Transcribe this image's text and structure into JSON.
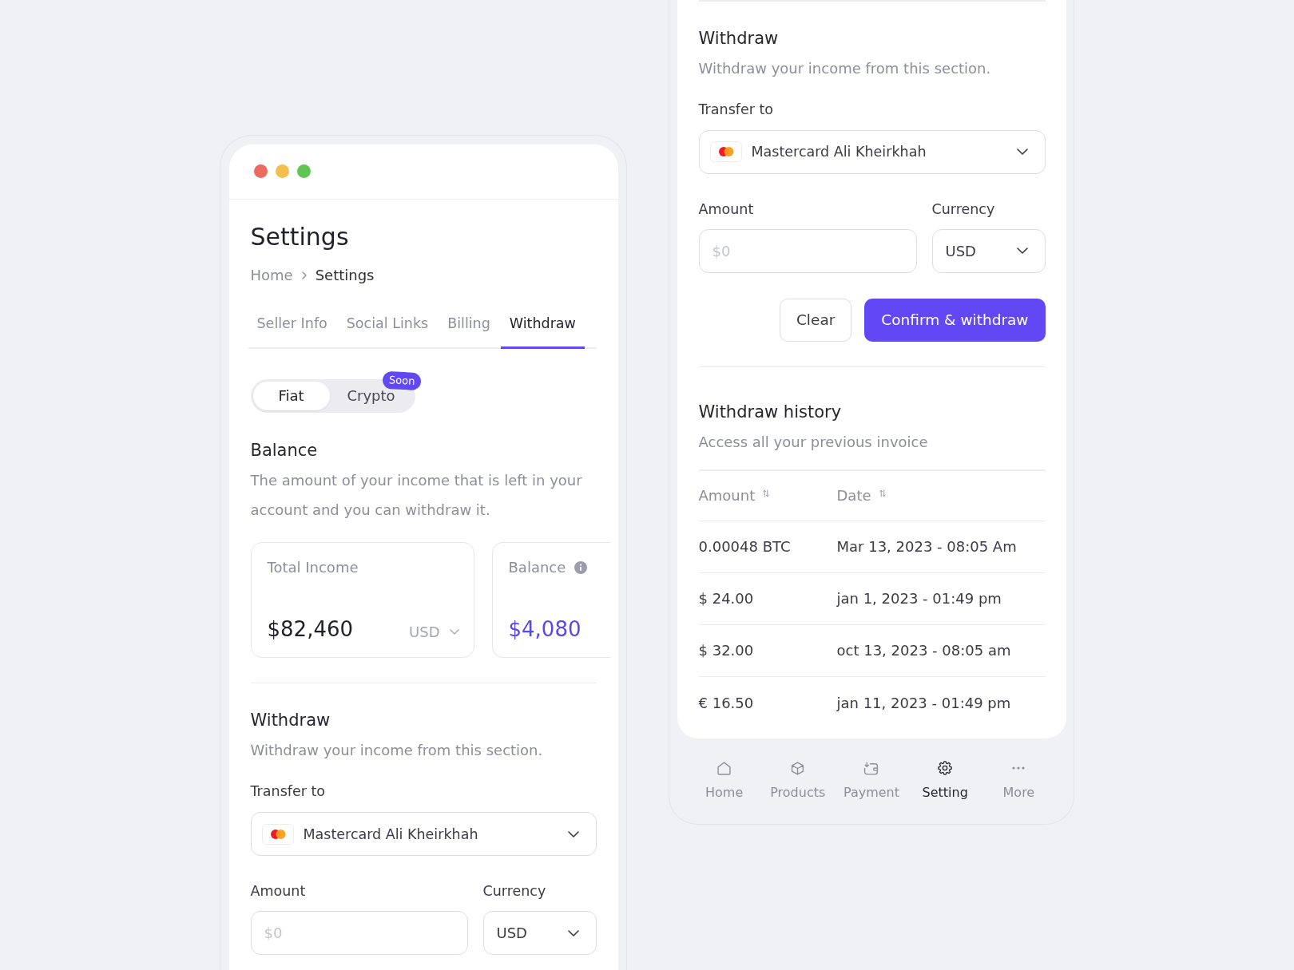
{
  "left_screen": {
    "window_dots": [
      {
        "color": "#ec6a5e"
      },
      {
        "color": "#f4bf4f"
      },
      {
        "color": "#61c554"
      }
    ],
    "title": "Settings",
    "breadcrumb": [
      {
        "label": "Home",
        "current": false
      },
      {
        "label": "Settings",
        "current": true
      }
    ],
    "tabs": [
      {
        "label": "Seller Info",
        "selected": false
      },
      {
        "label": "Social Links",
        "selected": false
      },
      {
        "label": "Billing",
        "selected": false
      },
      {
        "label": "Withdraw",
        "selected": true
      }
    ],
    "mode_toggle": [
      {
        "label": "Fiat",
        "selected": true
      },
      {
        "label": "Crypto",
        "selected": false,
        "badge": "Soon"
      }
    ],
    "balance": {
      "heading": "Balance",
      "description": "The amount of your income that is left in your account and you can withdraw it."
    },
    "stat_cards": [
      {
        "kind": "income",
        "label": "Total Income",
        "value": "$82,460",
        "currency": "USD"
      },
      {
        "kind": "balance",
        "label": "Balance",
        "value": "$4,080"
      }
    ],
    "withdraw": {
      "heading": "Withdraw",
      "description": "Withdraw your income from this section.",
      "transfer": {
        "label": "Transfer to",
        "value": "Mastercard Ali Kheirkhah"
      },
      "amount": {
        "label": "Amount",
        "placeholder": "$0"
      },
      "currency": {
        "label": "Currency",
        "value": "USD"
      }
    }
  },
  "right_screen": {
    "withdraw": {
      "heading": "Withdraw",
      "description": "Withdraw your income from this section.",
      "transfer": {
        "label": "Transfer to",
        "value": "Mastercard Ali Kheirkhah"
      },
      "amount": {
        "label": "Amount",
        "placeholder": "$0"
      },
      "currency": {
        "label": "Currency",
        "value": "USD"
      },
      "buttons": [
        {
          "kind": "secondary",
          "label": "Clear"
        },
        {
          "kind": "primary",
          "label": "Confirm & withdraw"
        }
      ]
    },
    "history": {
      "heading": "Withdraw history",
      "description": "Access all your previous invoice",
      "columns": [
        "Amount",
        "Date"
      ],
      "rows": [
        [
          "0.00048 BTC",
          "Mar 13, 2023 - 08:05 Am"
        ],
        [
          "$ 24.00",
          "jan 1, 2023 - 01:49 pm"
        ],
        [
          "$ 32.00",
          "oct 13, 2023 - 08:05 am"
        ],
        [
          "€ 16.50",
          "jan 11, 2023 - 01:49 pm"
        ]
      ]
    },
    "bottom_nav": [
      {
        "label": "Home",
        "selected": false
      },
      {
        "label": "Products",
        "selected": false
      },
      {
        "label": "Payment",
        "selected": false
      },
      {
        "label": "Setting",
        "selected": true
      },
      {
        "label": "More",
        "selected": false
      }
    ]
  }
}
